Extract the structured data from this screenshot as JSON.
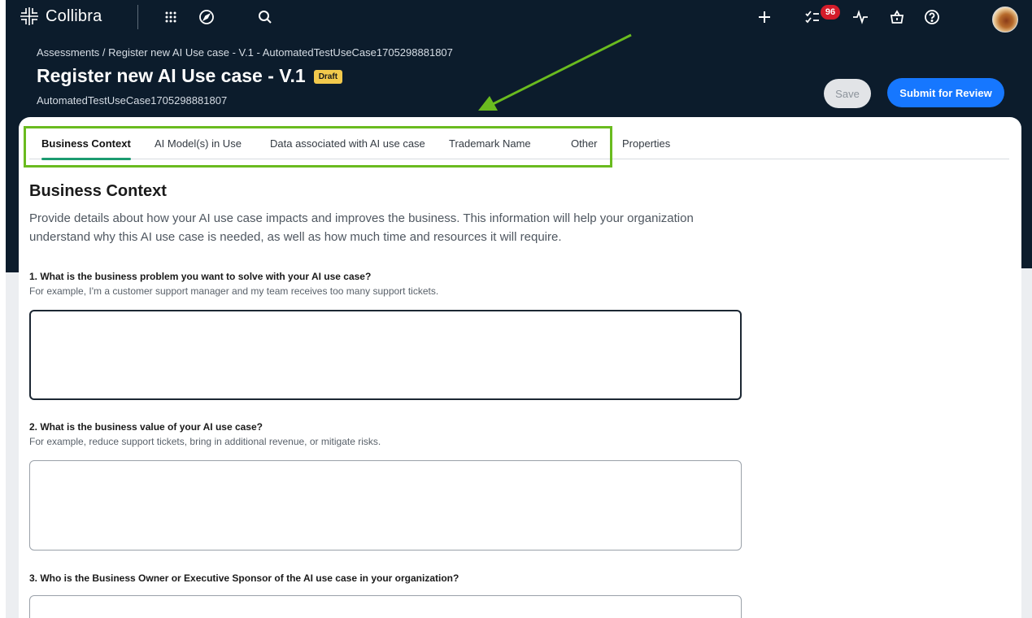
{
  "app": {
    "name": "Collibra",
    "notifications_count": "96"
  },
  "topbar_icons": [
    "apps-grid-icon",
    "compass-icon",
    "search-icon",
    "plus-icon",
    "tasks-icon",
    "activity-icon",
    "basket-icon",
    "help-icon"
  ],
  "header": {
    "breadcrumb_root": "Assessments",
    "breadcrumb_separator": " / ",
    "breadcrumb_current": "Register new AI Use case - V.1 - AutomatedTestUseCase1705298881807",
    "title": "Register new AI Use case - V.1",
    "status_badge": "Draft",
    "subtitle": "AutomatedTestUseCase1705298881807",
    "save_label": "Save",
    "submit_label": "Submit for Review"
  },
  "tabs": [
    {
      "label": "Business Context",
      "active": true
    },
    {
      "label": "AI Model(s) in Use",
      "active": false
    },
    {
      "label": "Data associated with AI use case",
      "active": false
    },
    {
      "label": "Trademark Name",
      "active": false
    },
    {
      "label": "Other",
      "active": false
    },
    {
      "label": "Properties",
      "active": false
    }
  ],
  "section": {
    "title": "Business Context",
    "description": "Provide details about how your AI use case impacts and improves the business. This information will help your organization understand why this AI use case is needed, as well as how much time and resources it will require."
  },
  "questions": [
    {
      "label": "1. What is the business problem you want to solve with your AI use case?",
      "help": "For example, I'm a customer support manager and my team receives too many support tickets.",
      "value": ""
    },
    {
      "label": "2. What is the business value of your AI use case?",
      "help": "For example, reduce support tickets, bring in additional revenue, or mitigate risks.",
      "value": ""
    },
    {
      "label": "3. Who is the Business Owner or Executive Sponsor of the AI use case in your organization?",
      "help": "",
      "value": ""
    }
  ],
  "colors": {
    "header_bg": "#0c1c2c",
    "primary_button": "#1677ff",
    "active_tab_underline": "#1c9b70",
    "annotation_green": "#6abb1f",
    "draft_badge": "#f2c94c",
    "notification_badge": "#d41c2a"
  }
}
